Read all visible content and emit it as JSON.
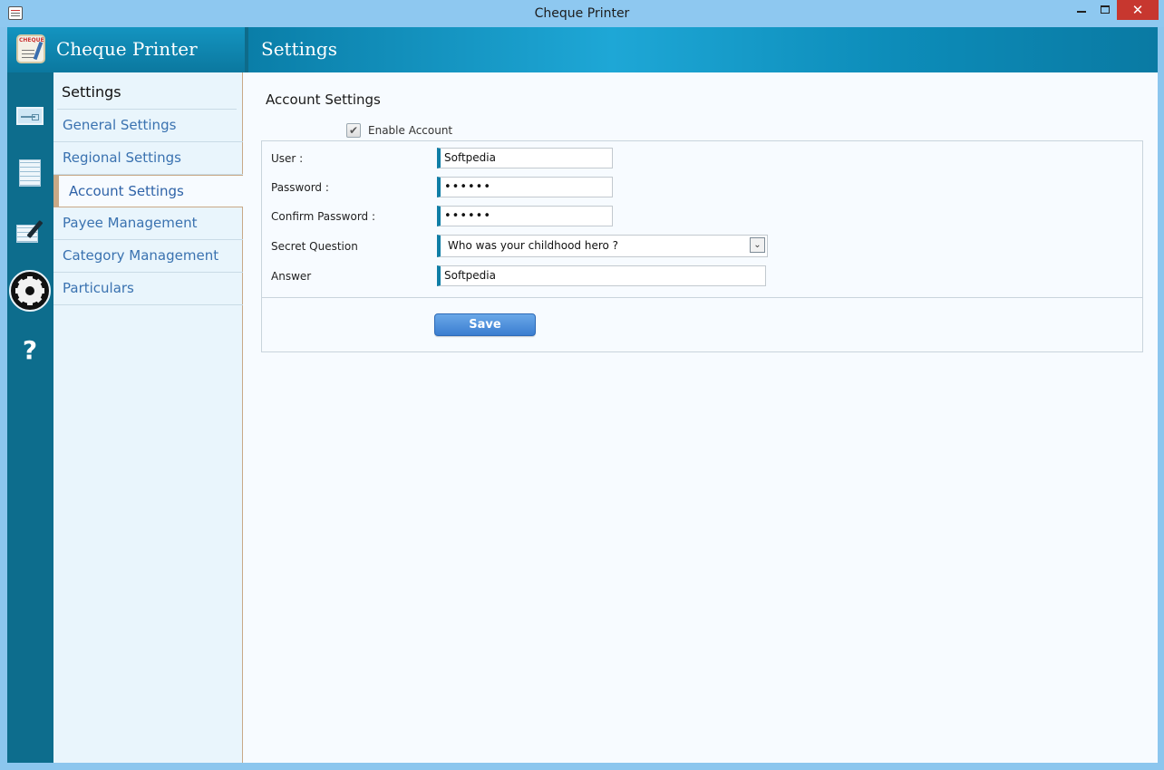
{
  "window": {
    "title": "Cheque Printer",
    "close_glyph": "✕"
  },
  "app": {
    "name": "Cheque Printer",
    "logo_tag": "CHEQUE"
  },
  "header": {
    "title": "Settings"
  },
  "rail": {
    "icons": [
      "cheque-icon",
      "report-icon",
      "edit-icon",
      "gear-icon",
      "help-icon"
    ],
    "help_glyph": "?"
  },
  "nav": {
    "heading": "Settings",
    "items": [
      {
        "label": "General Settings",
        "active": false
      },
      {
        "label": "Regional Settings",
        "active": false
      },
      {
        "label": "Account Settings",
        "active": true
      },
      {
        "label": "Payee Management",
        "active": false
      },
      {
        "label": "Category Management",
        "active": false
      },
      {
        "label": "Particulars",
        "active": false
      }
    ]
  },
  "account": {
    "title": "Account Settings",
    "enable_label": "Enable Account",
    "enable_checked": true,
    "check_glyph": "✔",
    "fields": {
      "user_label": "User :",
      "user_value": "Softpedia",
      "password_label": "Password :",
      "password_value": "••••••",
      "confirm_label": "Confirm Password :",
      "confirm_value": "••••••",
      "secret_label": "Secret Question",
      "secret_value": "Who was your childhood hero ?",
      "answer_label": "Answer",
      "answer_value": "Softpedia"
    },
    "select_arrow_glyph": "⌄",
    "save_label": "Save"
  },
  "colors": {
    "accent": "#0f7ea6",
    "rail": "#0d6d8d",
    "nav_link": "#3a72b0",
    "active_marker": "#c8a987",
    "button": "#3b7dd0"
  }
}
